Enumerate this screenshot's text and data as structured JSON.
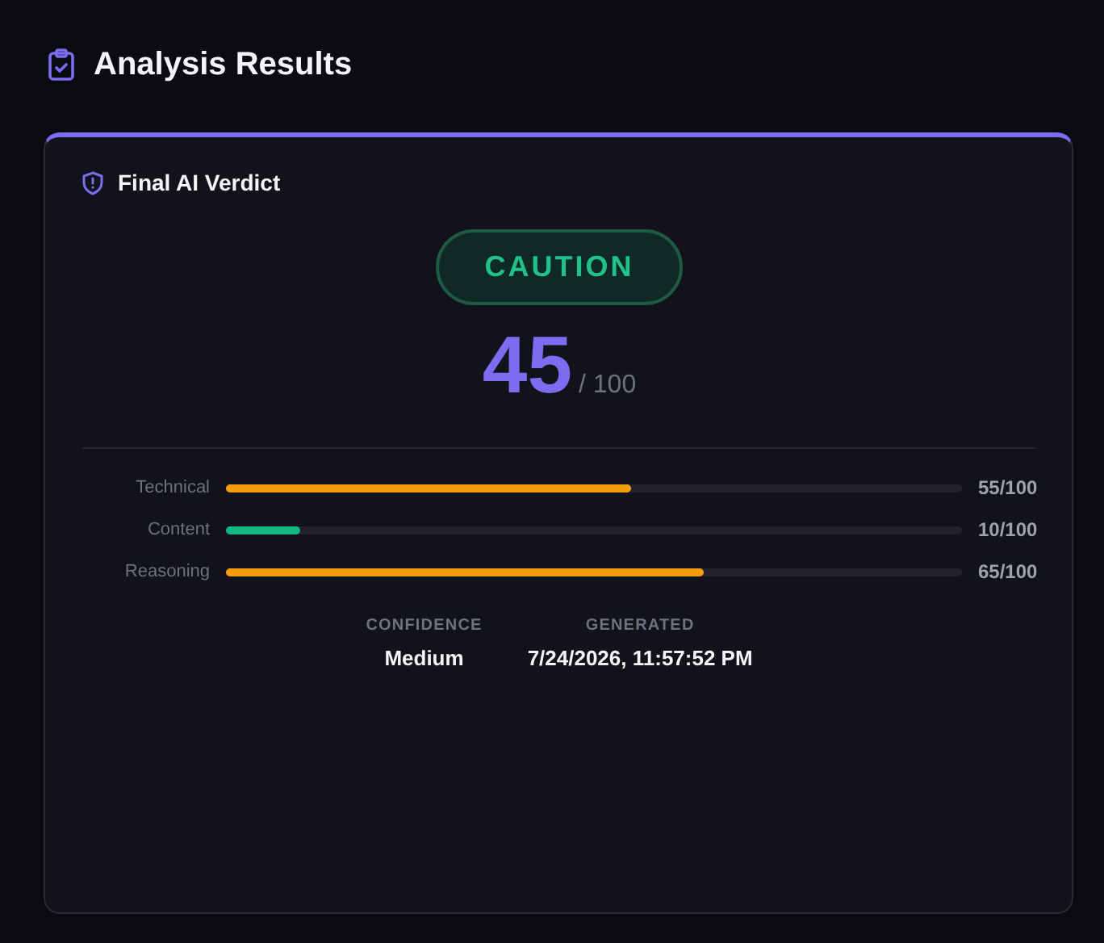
{
  "page_title": "Analysis Results",
  "card": {
    "title": "Final AI Verdict",
    "verdict": "CAUTION",
    "score": "45",
    "score_max": "/ 100",
    "metrics": [
      {
        "label": "Technical",
        "level": 0.55,
        "color": "#f59e0b",
        "reading": "55/100"
      },
      {
        "label": "Content",
        "level": 0.1,
        "color": "#10b981",
        "reading": "10/100"
      },
      {
        "label": "Reasoning",
        "level": 0.65,
        "color": "#f59e0b",
        "reading": "65/100"
      }
    ],
    "meta": [
      {
        "label": "CONFIDENCE",
        "value": "Medium"
      },
      {
        "label": "GENERATED",
        "value": "7/24/2026, 11:57:52 PM"
      }
    ]
  }
}
